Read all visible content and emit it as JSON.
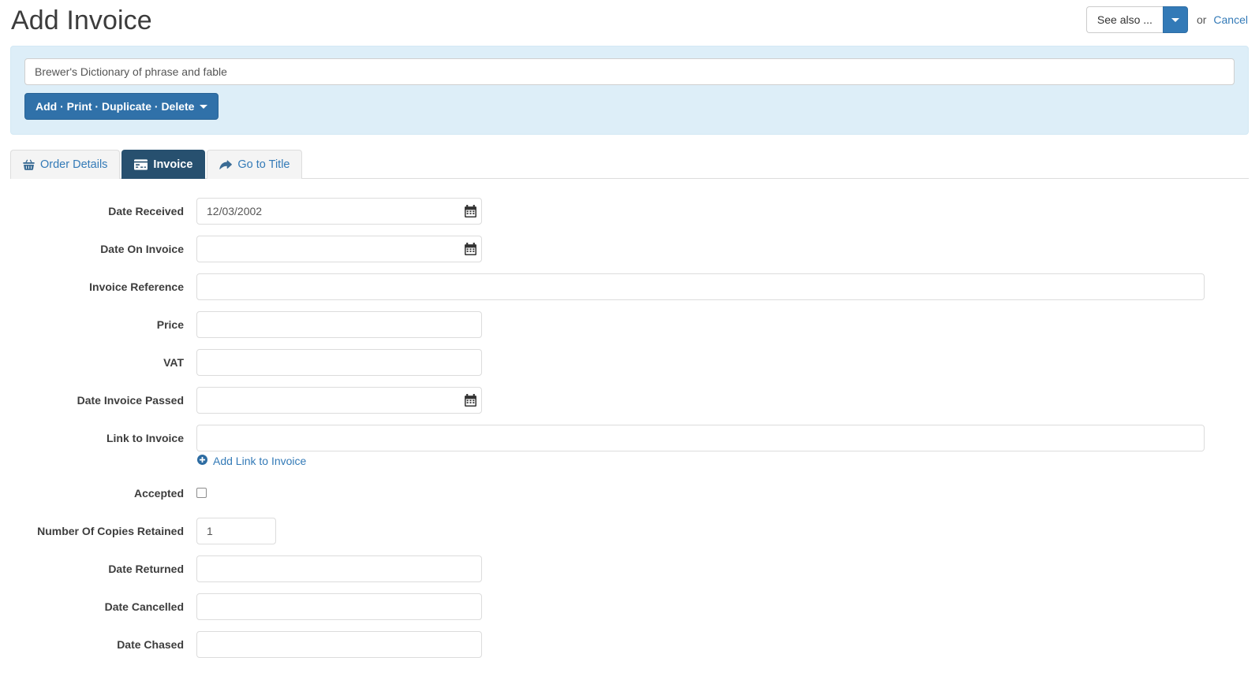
{
  "header": {
    "title": "Add Invoice",
    "see_also_label": "See also ...",
    "see_also_caret_icon": "caret-down-icon",
    "or_text": "or",
    "cancel_label": "Cancel"
  },
  "search_panel": {
    "record_title_value": "Brewer's Dictionary of phrase and fable",
    "record_title_placeholder": "",
    "actions_button_label": "Add · Print · Duplicate · Delete",
    "actions_caret_icon": "caret-down-icon",
    "background_color": "#ddeef8"
  },
  "tabs": [
    {
      "label": "Order Details",
      "icon": "shopping-basket-icon",
      "active": false
    },
    {
      "label": "Invoice",
      "icon": "credit-card-icon",
      "active": true
    },
    {
      "label": "Go to Title",
      "icon": "share-arrow-icon",
      "active": false
    }
  ],
  "form": {
    "fields": [
      {
        "label": "Date Received",
        "value": "12/03/2002",
        "width": "med",
        "calendar": true
      },
      {
        "label": "Date On Invoice",
        "value": "",
        "width": "med",
        "calendar": true
      },
      {
        "label": "Invoice Reference",
        "value": "",
        "width": "full",
        "calendar": false
      },
      {
        "label": "Price",
        "value": "",
        "width": "med",
        "calendar": false
      },
      {
        "label": "VAT",
        "value": "",
        "width": "med",
        "calendar": false
      },
      {
        "label": "Date Invoice Passed",
        "value": "",
        "width": "med",
        "calendar": true
      },
      {
        "label": "Link to Invoice",
        "value": "",
        "width": "full",
        "calendar": false
      }
    ],
    "add_link": {
      "label": "Add Link to Invoice",
      "icon": "plus-circle-icon"
    },
    "accepted": {
      "label": "Accepted",
      "checked": false
    },
    "copies": {
      "label": "Number Of Copies Retained",
      "value": "1"
    },
    "tail_fields": [
      {
        "label": "Date Returned",
        "value": "",
        "width": "med",
        "calendar": false
      },
      {
        "label": "Date Cancelled",
        "value": "",
        "width": "med",
        "calendar": false
      },
      {
        "label": "Date Chased",
        "value": "",
        "width": "med",
        "calendar": false
      }
    ]
  },
  "colors": {
    "accent_blue": "#337ab7",
    "active_tab": "#27506f",
    "primary_button": "#3071a9",
    "panel_blue": "#ddeef8"
  }
}
